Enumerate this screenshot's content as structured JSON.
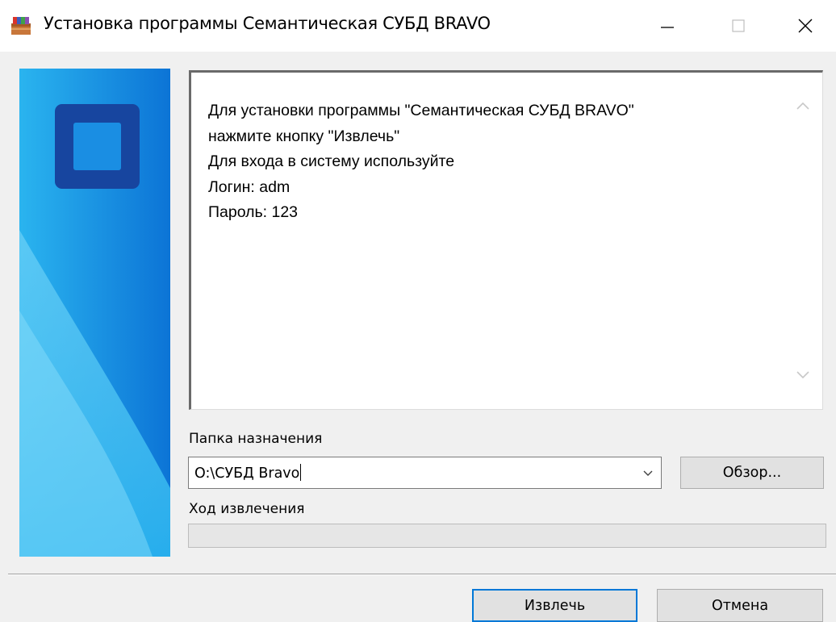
{
  "window": {
    "title": "Установка программы Семантическая СУБД BRAVO",
    "icon": "winrar-archive-icon"
  },
  "titlebar_buttons": {
    "minimize": "minimize-icon",
    "maximize": "maximize-icon",
    "close": "close-icon"
  },
  "readme": {
    "lines": [
      "Для установки программы \"Семантическая СУБД BRAVO\"",
      "нажмите кнопку \"Извлечь\"",
      "Для входа в систему используйте",
      "Логин: adm",
      "Пароль: 123"
    ]
  },
  "destination": {
    "label": "Папка назначения",
    "value": "O:\\СУБД Bravo",
    "browse_label": "Обзор..."
  },
  "progress": {
    "label": "Ход извлечения",
    "fraction": 0
  },
  "buttons": {
    "extract": "Извлечь",
    "cancel": "Отмена"
  },
  "colors": {
    "accent": "#0078d7",
    "banner_light": "#2ab4ef",
    "banner_dark": "#0c74d6",
    "logo": "#17459f"
  }
}
